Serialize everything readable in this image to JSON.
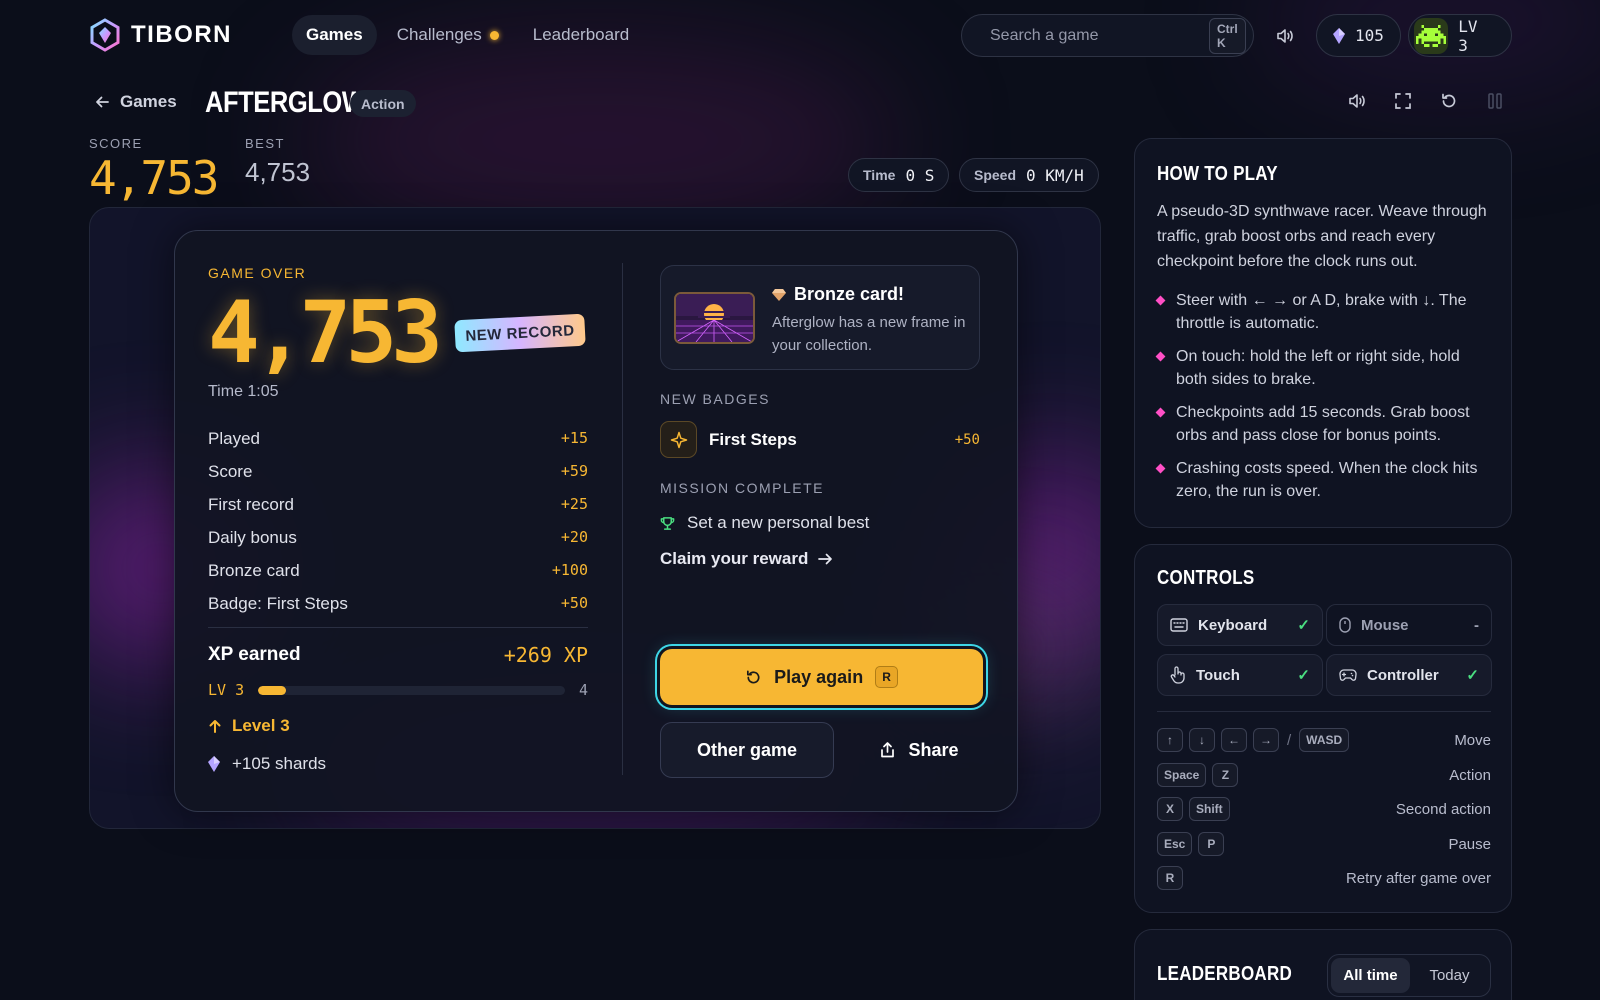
{
  "brand": {
    "name": "TIBORN"
  },
  "nav": [
    {
      "label": "Games",
      "active": true
    },
    {
      "label": "Challenges",
      "dot": true
    },
    {
      "label": "Leaderboard"
    }
  ],
  "search": {
    "placeholder": "Search a game",
    "shortcut": "Ctrl K"
  },
  "header": {
    "shards": "105",
    "level": "LV 3"
  },
  "breadcrumb": {
    "back_label": "Games"
  },
  "game": {
    "title": "AFTERGLOW",
    "genre": "Action"
  },
  "score": {
    "label": "SCORE",
    "value": "4,753",
    "best_label": "BEST",
    "best_value": "4,753"
  },
  "stats": {
    "time_label": "Time",
    "time_value": "0 S",
    "speed_label": "Speed",
    "speed_value": "0 KM/H"
  },
  "game_over": {
    "label": "GAME OVER",
    "score": "4,753",
    "record_badge": "NEW RECORD",
    "time": "Time 1:05",
    "rows": [
      {
        "label": "Played",
        "amount": "+15"
      },
      {
        "label": "Score",
        "amount": "+59"
      },
      {
        "label": "First record",
        "amount": "+25"
      },
      {
        "label": "Daily bonus",
        "amount": "+20"
      },
      {
        "label": "Bronze card",
        "amount": "+100"
      },
      {
        "label": "Badge: First Steps",
        "amount": "+50"
      }
    ],
    "xp_label": "XP earned",
    "xp_total": "+269 XP",
    "level_from": "LV 3",
    "level_to": "4",
    "level_progress": 0.09,
    "level_up": "Level 3",
    "shards": "+105 shards"
  },
  "reward": {
    "card_title": "Bronze card!",
    "card_desc": "Afterglow has a new frame in your collection.",
    "badges_label": "NEW BADGES",
    "badge_name": "First Steps",
    "badge_amount": "+50",
    "mission_label": "MISSION COMPLETE",
    "mission_text": "Set a new personal best",
    "claim_label": "Claim your reward"
  },
  "actions": {
    "play_again": "Play again",
    "play_key": "R",
    "other_game": "Other game",
    "share": "Share"
  },
  "how_to_play": {
    "title": "HOW TO PLAY",
    "intro": "A pseudo-3D synthwave racer. Weave through traffic, grab boost orbs and reach every checkpoint before the clock runs out.",
    "bullets": [
      "Steer with ← → or A D, brake with ↓. The throttle is automatic.",
      "On touch: hold the left or right side, hold both sides to brake.",
      "Checkpoints add 15 seconds. Grab boost orbs and pass close for bonus points.",
      "Crashing costs speed. When the clock hits zero, the run is over."
    ]
  },
  "controls": {
    "title": "CONTROLS",
    "devices": [
      {
        "label": "Keyboard",
        "status": "✓"
      },
      {
        "label": "Mouse",
        "status": "-"
      },
      {
        "label": "Touch",
        "status": "✓"
      },
      {
        "label": "Controller",
        "status": "✓"
      }
    ],
    "bindings": [
      {
        "keys": [
          "↑",
          "↓",
          "←",
          "→"
        ],
        "sep": "/",
        "alt": "WASD",
        "action": "Move"
      },
      {
        "keys": [
          "Space",
          "Z"
        ],
        "action": "Action"
      },
      {
        "keys": [
          "X",
          "Shift"
        ],
        "action": "Second action"
      },
      {
        "keys": [
          "Esc",
          "P"
        ],
        "action": "Pause"
      },
      {
        "keys": [
          "R"
        ],
        "action": "Retry after game over"
      }
    ]
  },
  "leaderboard": {
    "title": "LEADERBOARD",
    "tabs": [
      "All time",
      "Today"
    ]
  },
  "colors": {
    "accent": "#f7b733",
    "cyan": "#3ed6e6",
    "pink": "#ff4fc6",
    "green": "#4ade80",
    "background": "#0b0e1a"
  }
}
